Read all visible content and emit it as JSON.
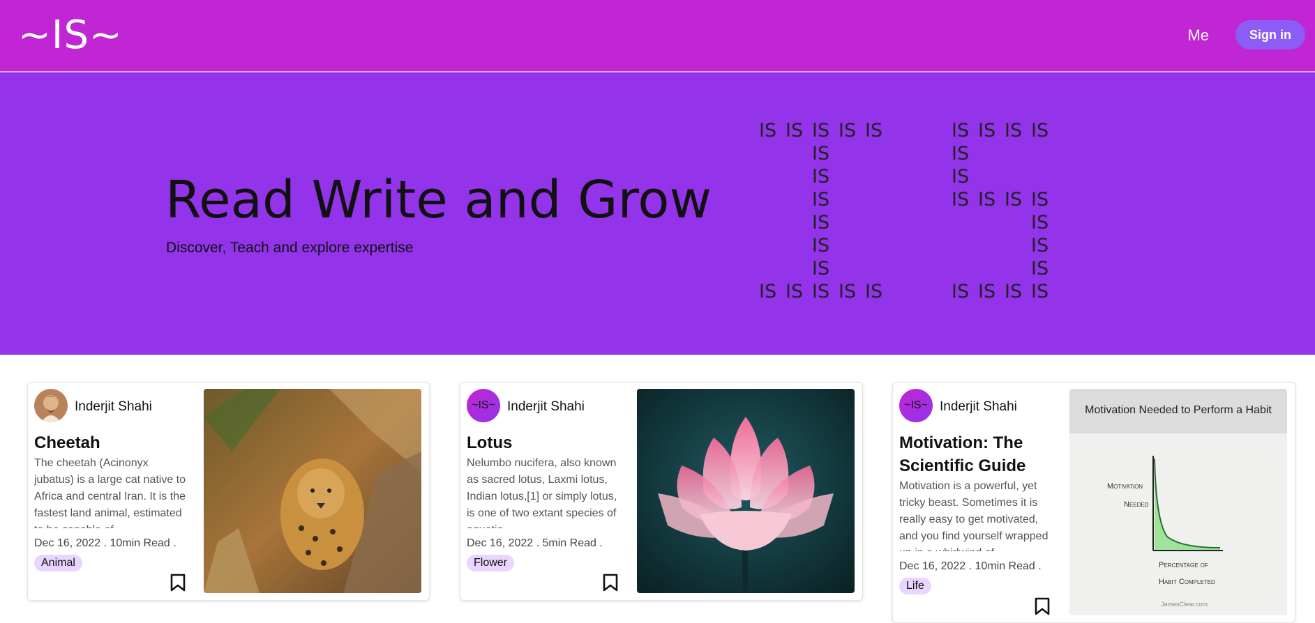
{
  "header": {
    "logo": "~IS~",
    "me_label": "Me",
    "signin_label": "Sign in"
  },
  "hero": {
    "title": "Read Write and Grow",
    "subtitle": "Discover, Teach and explore expertise",
    "art_token": "IS"
  },
  "colors": {
    "header_bg": "#c026d3",
    "hero_bg": "#9333ea",
    "signin_bg": "#8b5cf6",
    "tag_bg": "#e9d5ff"
  },
  "cards": [
    {
      "author": "Inderjit Shahi",
      "title": "Cheetah",
      "excerpt": "The cheetah (Acinonyx jubatus) is a large cat native to Africa and central Iran. It is the fastest land animal, estimated to be capable of",
      "meta": "Dec 16, 2022 . 10min Read .",
      "tag": "Animal",
      "avatar_type": "portrait",
      "image": "cheetah-photo"
    },
    {
      "author": "Inderjit Shahi",
      "title": "Lotus",
      "excerpt": "Nelumbo nucifera, also known as sacred lotus, Laxmi lotus, Indian lotus,[1] or simply lotus, is one of two extant species of aquatic",
      "meta": "Dec 16, 2022 . 5min Read .",
      "tag": "Flower",
      "avatar_text": "~IS~",
      "image": "lotus-photo"
    },
    {
      "author": "Inderjit Shahi",
      "title": "Motivation: The Scientific Guide",
      "excerpt": "Motivation is a powerful, yet tricky beast. Sometimes it is really easy to get motivated, and you find yourself wrapped up in a whirlwind of",
      "meta": "Dec 16, 2022 . 10min Read .",
      "tag": "Life",
      "avatar_text": "~IS~",
      "image": "motivation-chart",
      "image_text": {
        "heading": "Motivation Needed to Perform a Habit",
        "y_label_1": "Motivation",
        "y_label_2": "Needed",
        "x_label_1": "Percentage of",
        "x_label_2": "Habit Completed",
        "credit": "JamesClear.com"
      }
    }
  ]
}
